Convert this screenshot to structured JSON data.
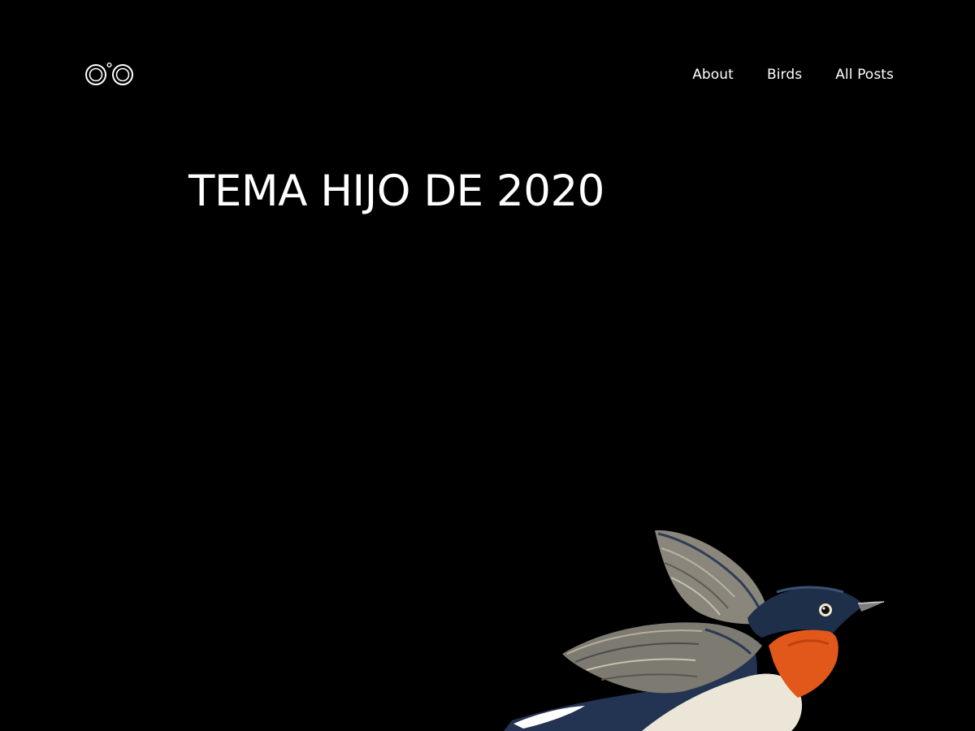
{
  "site": {
    "logo_icon": "binoculars-logo-icon",
    "nav": [
      {
        "label": "About"
      },
      {
        "label": "Birds"
      },
      {
        "label": "All Posts"
      }
    ]
  },
  "hero": {
    "title": "TEMA HIJO DE 2020",
    "image_icon": "bird-illustration"
  },
  "colors": {
    "background": "#000000",
    "text": "#ffffff",
    "bird_throat": "#e2571a",
    "bird_head": "#1e2f4a",
    "bird_wing": "#7d7a72"
  }
}
